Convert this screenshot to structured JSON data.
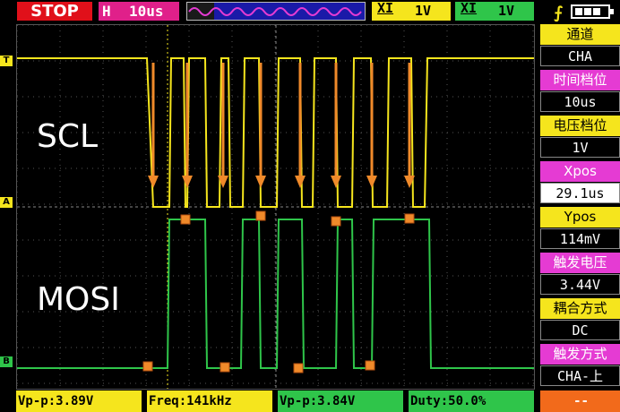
{
  "status": "STOP",
  "timebase": {
    "prefix": "H",
    "value": "10us"
  },
  "ch1_chip": {
    "key": "XI",
    "value": "1V"
  },
  "ch2_chip": {
    "key": "XI",
    "value": "1V"
  },
  "trigger_symbol": "⨍",
  "markers": {
    "trigger": "T",
    "ch_a": "A",
    "ch_b": "B"
  },
  "labels": {
    "scl": "SCL",
    "mosi": "MOSI"
  },
  "sidebar": [
    {
      "label": "通道",
      "value": "CHA",
      "label_color": "yellow"
    },
    {
      "label": "时间档位",
      "value": "10us",
      "label_color": "magenta"
    },
    {
      "label": "电压档位",
      "value": "1V",
      "label_color": "yellow"
    },
    {
      "label": "Xpos",
      "value": "29.1us",
      "label_color": "magenta",
      "selected": true
    },
    {
      "label": "Ypos",
      "value": "114mV",
      "label_color": "yellow"
    },
    {
      "label": "触发电压",
      "value": "3.44V",
      "label_color": "magenta"
    },
    {
      "label": "耦合方式",
      "value": "DC",
      "label_color": "yellow"
    },
    {
      "label": "触发方式",
      "value": "CHA-上",
      "label_color": "magenta"
    }
  ],
  "measurements": {
    "vpp1": "Vp-p:3.89V",
    "freq": "Freq:141kHz",
    "vpp2": "Vp-p:3.84V",
    "duty": "Duty:50.0%",
    "extra": "--"
  },
  "colors": {
    "ch1": "#f5e51d",
    "ch2": "#2fc54a",
    "arrow": "#f08a2a",
    "grid": "#555555"
  }
}
